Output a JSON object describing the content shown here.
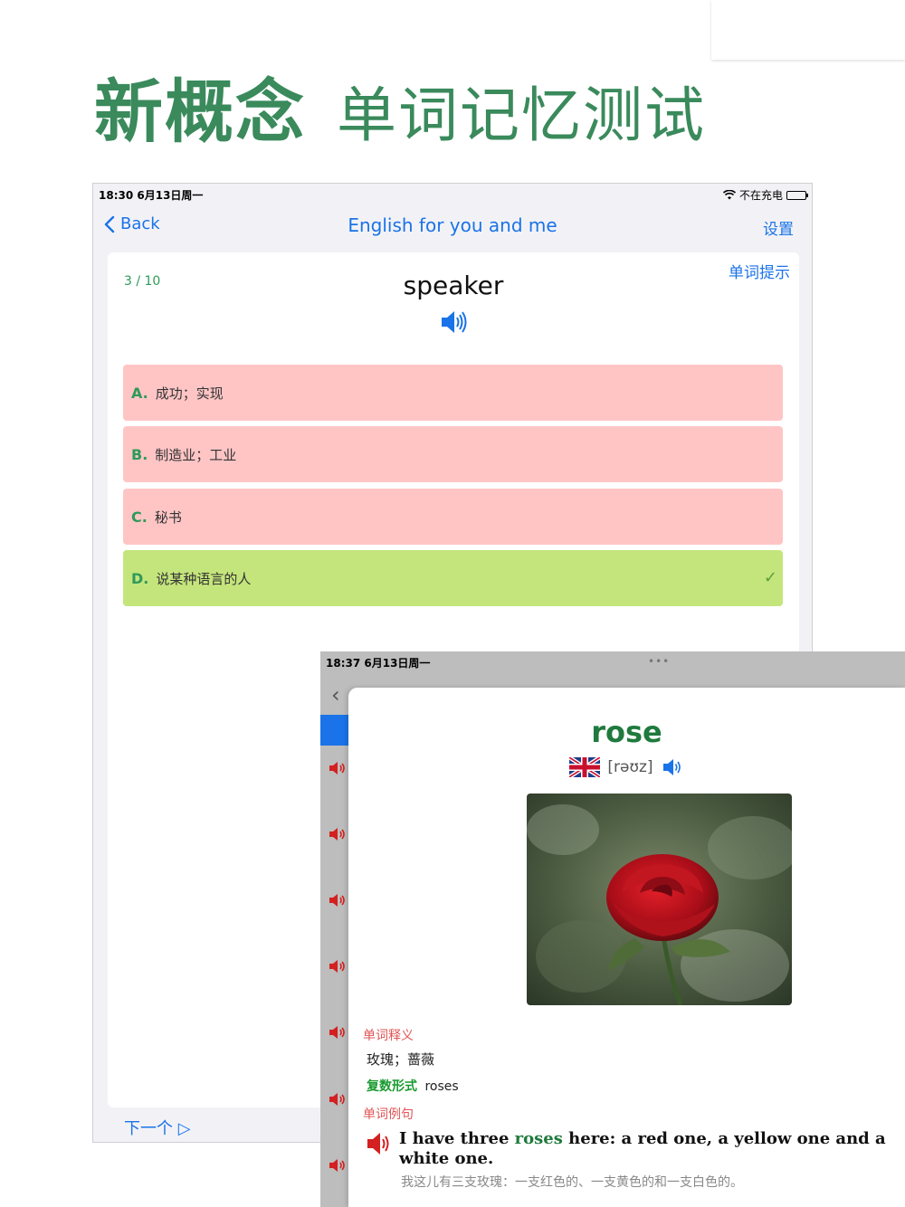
{
  "hero": {
    "title": "新概念",
    "subtitle": "单词记忆测试"
  },
  "device1": {
    "status": {
      "time": "18:30  6月13日周一",
      "charging": "不在充电"
    },
    "nav": {
      "back_label": "Back",
      "title": "English for you and me",
      "settings_label": "设置"
    },
    "quiz": {
      "progress": "3 / 10",
      "hint_label": "单词提示",
      "word": "speaker",
      "options": [
        {
          "letter": "A.",
          "text": "成功；实现",
          "state": "wrong"
        },
        {
          "letter": "B.",
          "text": "制造业；工业",
          "state": "wrong"
        },
        {
          "letter": "C.",
          "text": "秘书",
          "state": "wrong"
        },
        {
          "letter": "D.",
          "text": "说某种语言的人",
          "state": "correct"
        }
      ],
      "next_label": "下一个 ▷"
    }
  },
  "device2": {
    "status": {
      "time": "18:37  6月13日周一",
      "dots": "•••"
    },
    "detail": {
      "word": "rose",
      "phonetic": "[rəʊz]",
      "meaning_label": "单词释义",
      "meaning": "玫瑰；蔷薇",
      "plural_label": "复数形式",
      "plural_value": "roses",
      "example_label": "单词例句",
      "example_before": "I have three ",
      "example_highlight": "roses",
      "example_after": " here: a red one, a yellow one and a white one.",
      "example_translation": "我这儿有三支玫瑰：一支红色的、一支黄色的和一支白色的。"
    }
  },
  "colors": {
    "accent_green": "#3a8a5c",
    "link_blue": "#1a73e8",
    "wrong_bg": "#ffc5c5",
    "correct_bg": "#c4e57c",
    "label_red": "#e05555"
  }
}
